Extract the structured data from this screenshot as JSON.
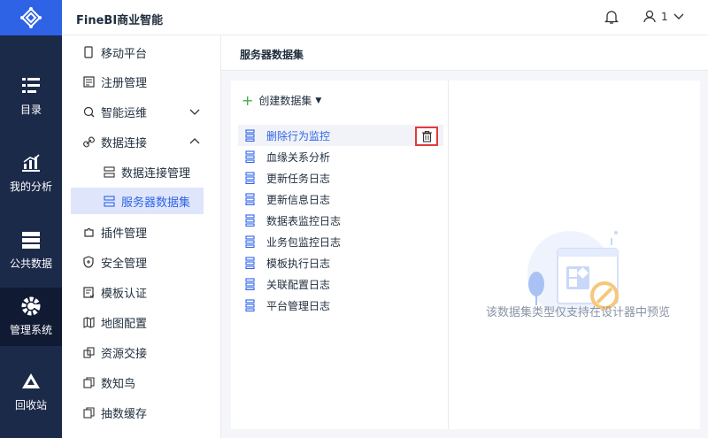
{
  "app": {
    "title": "FineBI商业智能"
  },
  "header": {
    "user_name": "1"
  },
  "rail": {
    "items": [
      {
        "label": "目录",
        "icon": "catalog-icon"
      },
      {
        "label": "我的分析",
        "icon": "analysis-icon"
      },
      {
        "label": "公共数据",
        "icon": "public-data-icon"
      },
      {
        "label": "管理系统",
        "icon": "gear-icon"
      },
      {
        "label": "回收站",
        "icon": "recycle-icon"
      }
    ]
  },
  "sidebar": {
    "items": [
      {
        "label": "移动平台",
        "icon": "mobile-icon"
      },
      {
        "label": "注册管理",
        "icon": "register-icon"
      },
      {
        "label": "智能运维",
        "icon": "ops-icon"
      },
      {
        "label": "数据连接",
        "icon": "link-icon"
      },
      {
        "label": "数据连接管理",
        "icon": "db-connect-icon"
      },
      {
        "label": "服务器数据集",
        "icon": "server-dataset-icon"
      },
      {
        "label": "插件管理",
        "icon": "plugin-icon"
      },
      {
        "label": "安全管理",
        "icon": "shield-icon"
      },
      {
        "label": "模板认证",
        "icon": "template-auth-icon"
      },
      {
        "label": "地图配置",
        "icon": "map-icon"
      },
      {
        "label": "资源交接",
        "icon": "handover-icon"
      },
      {
        "label": "数知鸟",
        "icon": "bird-icon"
      },
      {
        "label": "抽数缓存",
        "icon": "cache-icon"
      }
    ]
  },
  "main": {
    "title": "服务器数据集",
    "create_label": "创建数据集",
    "datasets": [
      "删除行为监控",
      "血缘关系分析",
      "更新任务日志",
      "更新信息日志",
      "数据表监控日志",
      "业务包监控日志",
      "模板执行日志",
      "关联配置日志",
      "平台管理日志"
    ],
    "preview_text": "该数据集类型仅支持在设计器中预览"
  },
  "colors": {
    "rail_bg": "#1c2a4a",
    "accent": "#2f63e6",
    "highlight": "#e23b3b",
    "plus_green": "#3fae49"
  }
}
